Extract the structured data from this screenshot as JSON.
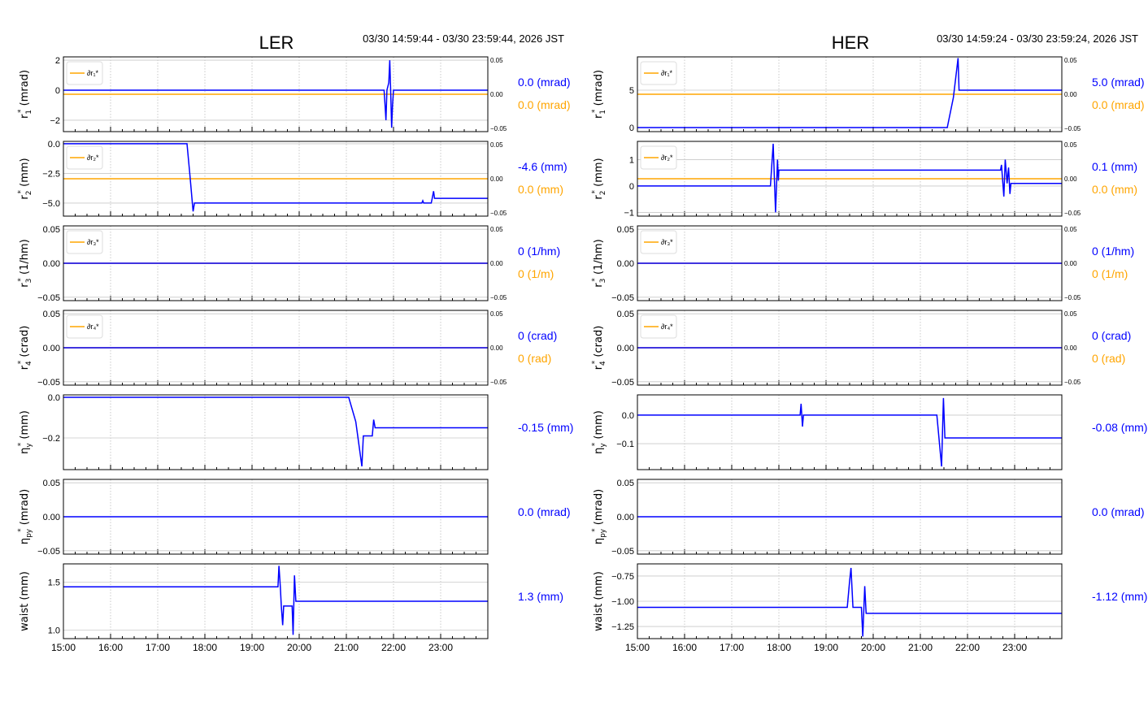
{
  "chart_data": [
    {
      "type": "line",
      "title": "LER",
      "time_range": "03/30 14:59:44 - 03/30 23:59:44, 2026 JST",
      "xlim": [
        15,
        24
      ],
      "xticks": [
        "15:00",
        "16:00",
        "17:00",
        "18:00",
        "19:00",
        "20:00",
        "21:00",
        "22:00",
        "23:00"
      ],
      "panels": [
        {
          "ylabel": {
            "sym": "r",
            "sub": "1",
            "sup": "*",
            "unit": "(mrad)"
          },
          "ylim": [
            -2.76,
            2.22
          ],
          "yticks": [
            2,
            0,
            -2
          ],
          "ytick_labels": [
            "2",
            "0",
            "−2"
          ],
          "legend": "∂r₁*",
          "right_axis": true,
          "value_blue": "0.0 (mrad)",
          "value_orange": "0.0 (mrad)",
          "blue": [
            [
              15,
              0
            ],
            [
              21.8,
              0
            ],
            [
              21.82,
              -1
            ],
            [
              21.84,
              -2
            ],
            [
              21.86,
              0
            ],
            [
              21.9,
              0.5
            ],
            [
              21.92,
              2
            ],
            [
              21.94,
              0
            ],
            [
              21.96,
              -2.5
            ],
            [
              21.98,
              -1
            ],
            [
              22,
              0
            ],
            [
              24,
              0
            ]
          ],
          "orange": 0
        },
        {
          "ylabel": {
            "sym": "r",
            "sub": "2",
            "sup": "*",
            "unit": "(mm)"
          },
          "ylim": [
            -6.1,
            0.2
          ],
          "yticks": [
            0,
            -2.5,
            -5
          ],
          "ytick_labels": [
            "0.0",
            "−2.5",
            "−5.0"
          ],
          "legend": "∂r₂*",
          "right_axis": true,
          "value_blue": "-4.6 (mm)",
          "value_orange": "0.0 (mm)",
          "blue": [
            [
              15,
              0
            ],
            [
              17.62,
              0
            ],
            [
              17.68,
              -2.5
            ],
            [
              17.75,
              -5.7
            ],
            [
              17.78,
              -5.0
            ],
            [
              22.6,
              -5.0
            ],
            [
              22.62,
              -4.8
            ],
            [
              22.64,
              -5.0
            ],
            [
              22.8,
              -5.0
            ],
            [
              22.82,
              -4.6
            ],
            [
              22.85,
              -4.0
            ],
            [
              22.87,
              -4.6
            ],
            [
              24,
              -4.6
            ]
          ],
          "orange": 0
        },
        {
          "ylabel": {
            "sym": "r",
            "sub": "3",
            "sup": "*",
            "unit": "(1/hm)"
          },
          "ylim": [
            -0.055,
            0.055
          ],
          "yticks": [
            0.05,
            0,
            -0.05
          ],
          "ytick_labels": [
            "0.05",
            "0.00",
            "−0.05"
          ],
          "legend": "∂r₃*",
          "right_axis": true,
          "value_blue": "0 (1/hm)",
          "value_orange": "0 (1/m)",
          "blue": [
            [
              15,
              0
            ],
            [
              24,
              0
            ]
          ],
          "orange": 0
        },
        {
          "ylabel": {
            "sym": "r",
            "sub": "4",
            "sup": "*",
            "unit": "(crad)"
          },
          "ylim": [
            -0.055,
            0.055
          ],
          "yticks": [
            0.05,
            0,
            -0.05
          ],
          "ytick_labels": [
            "0.05",
            "0.00",
            "−0.05"
          ],
          "legend": "∂r₄*",
          "right_axis": true,
          "value_blue": "0 (crad)",
          "value_orange": "0 (rad)",
          "blue": [
            [
              15,
              0
            ],
            [
              24,
              0
            ]
          ],
          "orange": 0
        },
        {
          "ylabel": {
            "sym": "η",
            "sub": "y",
            "sup": "*",
            "unit": "(mm)"
          },
          "ylim": [
            -0.356,
            0.012
          ],
          "yticks": [
            0,
            -0.2
          ],
          "ytick_labels": [
            "0.0",
            "−0.2"
          ],
          "value_blue": "-0.15 (mm)",
          "blue": [
            [
              15,
              0
            ],
            [
              21.05,
              0
            ],
            [
              21.2,
              -0.12
            ],
            [
              21.33,
              -0.34
            ],
            [
              21.36,
              -0.19
            ],
            [
              21.55,
              -0.19
            ],
            [
              21.58,
              -0.11
            ],
            [
              21.61,
              -0.15
            ],
            [
              24,
              -0.15
            ]
          ]
        },
        {
          "ylabel": {
            "sym": "η",
            "sub": "py",
            "sup": "*",
            "unit": "(mrad)"
          },
          "ylim": [
            -0.055,
            0.055
          ],
          "yticks": [
            0.05,
            0,
            -0.05
          ],
          "ytick_labels": [
            "0.05",
            "0.00",
            "−0.05"
          ],
          "value_blue": "0.0 (mrad)",
          "blue": [
            [
              15,
              0
            ],
            [
              24,
              0
            ]
          ]
        },
        {
          "ylabel": {
            "sym": "waist",
            "sub": "",
            "sup": "",
            "unit": "(mm)"
          },
          "ylim": [
            0.91,
            1.69
          ],
          "yticks": [
            1.5,
            1.0
          ],
          "ytick_labels": [
            "1.5",
            "1.0"
          ],
          "value_blue": "1.3 (mm)",
          "blue": [
            [
              15,
              1.45
            ],
            [
              19.55,
              1.45
            ],
            [
              19.57,
              1.67
            ],
            [
              19.6,
              1.45
            ],
            [
              19.62,
              1.25
            ],
            [
              19.65,
              1.05
            ],
            [
              19.67,
              1.25
            ],
            [
              19.85,
              1.25
            ],
            [
              19.87,
              0.95
            ],
            [
              19.9,
              1.57
            ],
            [
              19.93,
              1.3
            ],
            [
              24,
              1.3
            ]
          ]
        }
      ]
    },
    {
      "type": "line",
      "title": "HER",
      "time_range": "03/30 14:59:24 - 03/30 23:59:24, 2026 JST",
      "xlim": [
        15,
        24
      ],
      "xticks": [
        "15:00",
        "16:00",
        "17:00",
        "18:00",
        "19:00",
        "20:00",
        "21:00",
        "22:00",
        "23:00"
      ],
      "panels": [
        {
          "ylabel": {
            "sym": "r",
            "sub": "1",
            "sup": "*",
            "unit": "(mrad)"
          },
          "ylim": [
            -0.54,
            9.46
          ],
          "yticks": [
            5,
            0
          ],
          "ytick_labels": [
            "5",
            "0"
          ],
          "legend": "∂r₁*",
          "right_axis": true,
          "value_blue": "5.0 (mrad)",
          "value_orange": "0.0 (mrad)",
          "blue": [
            [
              15,
              0
            ],
            [
              21.57,
              0
            ],
            [
              21.7,
              4
            ],
            [
              21.8,
              9.3
            ],
            [
              21.82,
              5.0
            ],
            [
              24,
              5.0
            ]
          ],
          "orange": 0
        },
        {
          "ylabel": {
            "sym": "r",
            "sub": "2",
            "sup": "*",
            "unit": "(mm)"
          },
          "ylim": [
            -1.14,
            1.69
          ],
          "yticks": [
            1,
            0,
            -1
          ],
          "ytick_labels": [
            "1",
            "0",
            "−1"
          ],
          "legend": "∂r₂*",
          "right_axis": true,
          "value_blue": "0.1 (mm)",
          "value_orange": "0.0 (mm)",
          "blue": [
            [
              15,
              0
            ],
            [
              17.82,
              0
            ],
            [
              17.88,
              1.6
            ],
            [
              17.93,
              -1
            ],
            [
              17.97,
              1.0
            ],
            [
              17.99,
              0.2
            ],
            [
              18.0,
              0.6
            ],
            [
              22.7,
              0.6
            ],
            [
              22.72,
              0.8
            ],
            [
              22.77,
              -0.4
            ],
            [
              22.8,
              1.0
            ],
            [
              22.84,
              0.1
            ],
            [
              22.87,
              0.7
            ],
            [
              22.9,
              -0.3
            ],
            [
              22.92,
              0.1
            ],
            [
              24,
              0.1
            ]
          ],
          "orange": 0
        },
        {
          "ylabel": {
            "sym": "r",
            "sub": "3",
            "sup": "*",
            "unit": "(1/hm)"
          },
          "ylim": [
            -0.055,
            0.055
          ],
          "yticks": [
            0.05,
            0,
            -0.05
          ],
          "ytick_labels": [
            "0.05",
            "0.00",
            "−0.05"
          ],
          "legend": "∂r₃*",
          "right_axis": true,
          "value_blue": "0 (1/hm)",
          "value_orange": "0 (1/m)",
          "blue": [
            [
              15,
              0
            ],
            [
              24,
              0
            ]
          ],
          "orange": 0
        },
        {
          "ylabel": {
            "sym": "r",
            "sub": "4",
            "sup": "*",
            "unit": "(crad)"
          },
          "ylim": [
            -0.055,
            0.055
          ],
          "yticks": [
            0.05,
            0,
            -0.05
          ],
          "ytick_labels": [
            "0.05",
            "0.00",
            "−0.05"
          ],
          "legend": "∂r₄*",
          "right_axis": true,
          "value_blue": "0 (crad)",
          "value_orange": "0 (rad)",
          "blue": [
            [
              15,
              0
            ],
            [
              24,
              0
            ]
          ],
          "orange": 0
        },
        {
          "ylabel": {
            "sym": "η",
            "sub": "y",
            "sup": "*",
            "unit": "(mm)"
          },
          "ylim": [
            -0.191,
            0.071
          ],
          "yticks": [
            0,
            -0.1
          ],
          "ytick_labels": [
            "0.0",
            "−0.1"
          ],
          "value_blue": "-0.08 (mm)",
          "blue": [
            [
              15,
              0
            ],
            [
              18.45,
              0
            ],
            [
              18.47,
              0.04
            ],
            [
              18.5,
              -0.04
            ],
            [
              18.52,
              0
            ],
            [
              21.35,
              0
            ],
            [
              21.45,
              -0.18
            ],
            [
              21.49,
              0.06
            ],
            [
              21.52,
              -0.08
            ],
            [
              24,
              -0.08
            ]
          ]
        },
        {
          "ylabel": {
            "sym": "η",
            "sub": "py",
            "sup": "*",
            "unit": "(mrad)"
          },
          "ylim": [
            -0.055,
            0.055
          ],
          "yticks": [
            0.05,
            0,
            -0.05
          ],
          "ytick_labels": [
            "0.05",
            "0.00",
            "−0.05"
          ],
          "value_blue": "0.0 (mrad)",
          "blue": [
            [
              15,
              0
            ],
            [
              24,
              0
            ]
          ]
        },
        {
          "ylabel": {
            "sym": "waist",
            "sub": "",
            "sup": "",
            "unit": "(mm)"
          },
          "ylim": [
            -1.37,
            -0.63
          ],
          "yticks": [
            -0.75,
            -1.0,
            -1.25
          ],
          "ytick_labels": [
            "−0.75",
            "−1.00",
            "−1.25"
          ],
          "value_blue": "-1.12 (mm)",
          "blue": [
            [
              15,
              -1.06
            ],
            [
              19.45,
              -1.06
            ],
            [
              19.5,
              -0.8
            ],
            [
              19.53,
              -0.67
            ],
            [
              19.57,
              -1.06
            ],
            [
              19.75,
              -1.06
            ],
            [
              19.78,
              -1.35
            ],
            [
              19.82,
              -0.85
            ],
            [
              19.85,
              -1.12
            ],
            [
              24,
              -1.12
            ]
          ]
        }
      ]
    }
  ],
  "colors": {
    "blue": "#0000ff",
    "orange": "#ffa500",
    "grid": "#c8c8c8"
  },
  "right_axis_ticks": [
    "0.05",
    "0.00",
    "−0.05"
  ]
}
